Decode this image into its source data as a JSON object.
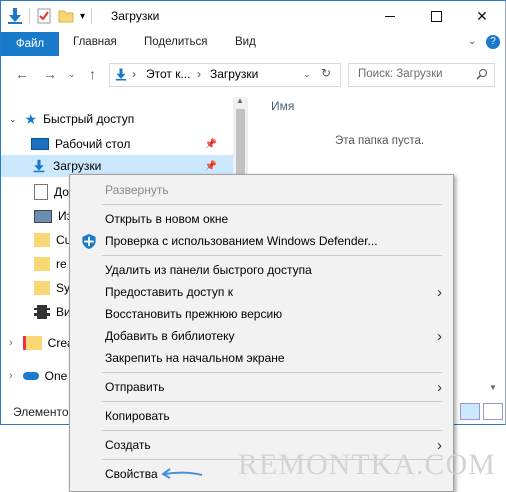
{
  "window": {
    "title": "Загрузки"
  },
  "ribbon": {
    "tabs": [
      "Файл",
      "Главная",
      "Поделиться",
      "Вид"
    ]
  },
  "address": {
    "segments": [
      "Этот к...",
      "Загрузки"
    ],
    "separator": "›"
  },
  "search": {
    "placeholder": "Поиск: Загрузки"
  },
  "nav": {
    "quick_access": "Быстрый доступ",
    "items": [
      {
        "label": "Рабочий стол",
        "icon": "desktop-icon",
        "pinned": true
      },
      {
        "label": "Загрузки",
        "icon": "downloads-icon",
        "pinned": true,
        "selected": true
      },
      {
        "label": "До",
        "icon": "documents-icon"
      },
      {
        "label": "Из",
        "icon": "pictures-icon"
      },
      {
        "label": "Cu",
        "icon": "folder-icon"
      },
      {
        "label": "re",
        "icon": "folder-icon"
      },
      {
        "label": "Sy",
        "icon": "folder-icon"
      },
      {
        "label": "Ви",
        "icon": "video-icon"
      }
    ],
    "creative": "Crea",
    "onedrive": "One"
  },
  "content": {
    "column_header": "Имя",
    "empty_text": "Эта папка пуста."
  },
  "status_text": "Элементо",
  "context_menu": {
    "items": [
      {
        "label": "Развернуть",
        "disabled": true
      },
      {
        "label": "Открыть в новом окне"
      },
      {
        "label": "Проверка с использованием Windows Defender...",
        "icon": "windows-defender-icon"
      },
      {
        "label": "Удалить из панели быстрого доступа"
      },
      {
        "label": "Предоставить доступ к",
        "submenu": true
      },
      {
        "label": "Восстановить прежнюю версию"
      },
      {
        "label": "Добавить в библиотеку",
        "submenu": true
      },
      {
        "label": "Закрепить на начальном экране"
      },
      {
        "label": "Отправить",
        "submenu": true
      },
      {
        "label": "Копировать"
      },
      {
        "label": "Создать",
        "submenu": true
      },
      {
        "label": "Свойства"
      }
    ]
  },
  "watermark": "REMONTKA.COM",
  "colors": {
    "accent": "#1979ca",
    "selection": "#cce8ff",
    "menu_bg": "#f2f2f2",
    "hand_arrow": "#4a90d9"
  }
}
